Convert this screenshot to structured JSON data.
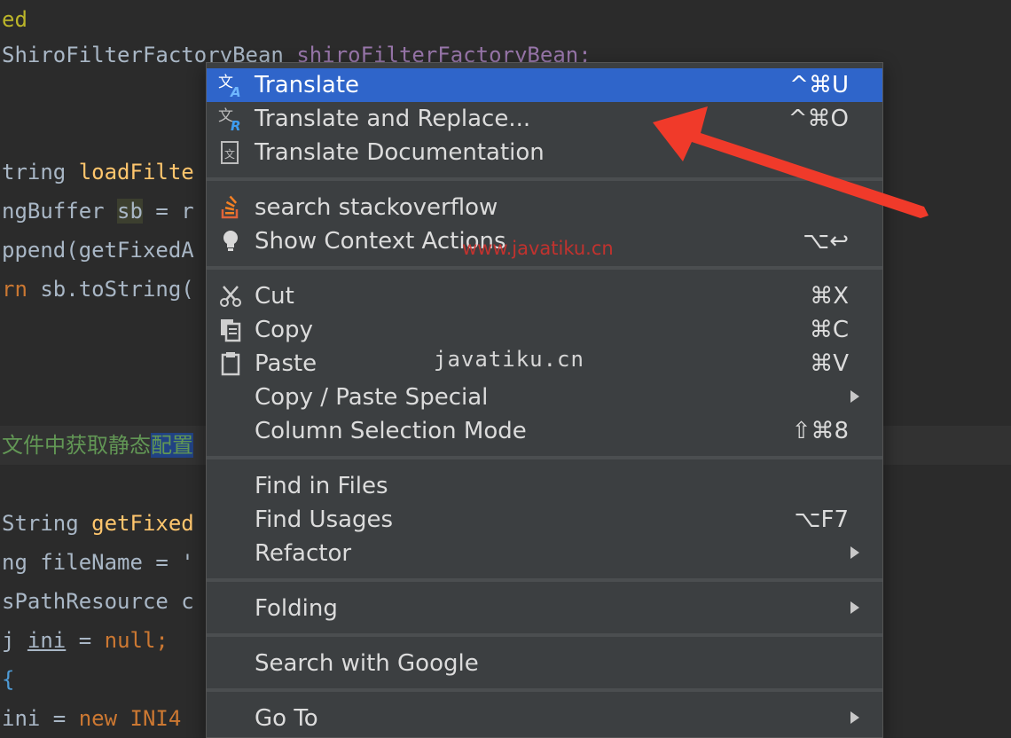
{
  "editor": {
    "lines": [
      {
        "a": "ed"
      },
      {
        "a": "ShiroFilterFactoryBean ",
        "b": "shiroFilterFactoryBean;"
      },
      {
        "a": "tring ",
        "b": "loadFilte"
      },
      {
        "a": "ngBuffer ",
        "b": "sb",
        " c": " = r"
      },
      {
        "a": "ppend(",
        "b": "getFixedA"
      },
      {
        "a": "rn ",
        "b": "sb.toString("
      },
      {
        "a": "文件中获取静态",
        "b": "配置"
      },
      {
        "a": "String ",
        "b": "getFixed"
      },
      {
        "a": "ng ",
        "b": "fileName = '"
      },
      {
        "a": "sPathResource c"
      },
      {
        "a": "j ",
        "b": "ini",
        " c": " = ",
        "d": "null;"
      },
      {
        "a": "{"
      },
      {
        "a": "ini = ",
        "b": "new INI4"
      }
    ]
  },
  "menu": {
    "items": [
      {
        "label": "Translate",
        "shortcut": "^⌘U"
      },
      {
        "label": "Translate and Replace...",
        "shortcut": "^⌘O"
      },
      {
        "label": "Translate Documentation",
        "shortcut": ""
      },
      {
        "label": "search stackoverflow",
        "shortcut": ""
      },
      {
        "label": "Show Context Actions",
        "shortcut": "⌥↩"
      },
      {
        "label": "Cut",
        "shortcut": "⌘X"
      },
      {
        "label": "Copy",
        "shortcut": "⌘C"
      },
      {
        "label": "Paste",
        "shortcut": "⌘V"
      },
      {
        "label": "Copy / Paste Special",
        "shortcut": ""
      },
      {
        "label": "Column Selection Mode",
        "shortcut": "⇧⌘8"
      },
      {
        "label": "Find in Files",
        "shortcut": ""
      },
      {
        "label": "Find Usages",
        "shortcut": "⌥F7"
      },
      {
        "label": "Refactor",
        "shortcut": ""
      },
      {
        "label": "Folding",
        "shortcut": ""
      },
      {
        "label": "Search with Google",
        "shortcut": ""
      },
      {
        "label": "Go To",
        "shortcut": ""
      }
    ]
  },
  "watermarks": {
    "red": "www.javatiku.cn",
    "gray": "javatiku.cn"
  },
  "icons": {
    "translate": "translate-icon",
    "translate_replace": "translate-replace-icon",
    "translate_doc": "translate-doc-icon",
    "stackoverflow": "stackoverflow-icon",
    "bulb": "lightbulb-icon",
    "cut": "scissors-icon",
    "copy": "copy-icon",
    "paste": "paste-icon"
  },
  "colors": {
    "menu_bg": "#3c3f41",
    "selected": "#2f65ca",
    "arrow": "#f03a2a",
    "editor_bg": "#2b2b2b"
  }
}
